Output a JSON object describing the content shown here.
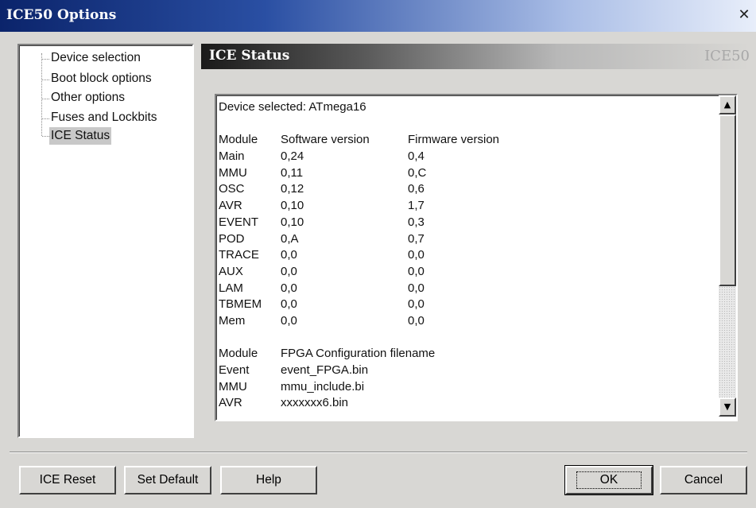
{
  "window": {
    "title": "ICE50 Options",
    "close_glyph": "✕"
  },
  "tree": {
    "items": [
      {
        "label": "Device selection"
      },
      {
        "label": "Boot block options"
      },
      {
        "label": "Other options"
      },
      {
        "label": "Fuses and Lockbits"
      },
      {
        "label": "ICE Status",
        "selected": true
      }
    ]
  },
  "panel": {
    "title": "ICE Status",
    "brand": "ICE50"
  },
  "status": {
    "device_line": "Device selected: ATmega16",
    "versions_header": [
      "Module",
      "Software version",
      "Firmware version"
    ],
    "versions": [
      [
        "Main",
        "0,24",
        "0,4"
      ],
      [
        "MMU",
        "0,11",
        "0,C"
      ],
      [
        "OSC",
        "0,12",
        "0,6"
      ],
      [
        "AVR",
        "0,10",
        "1,7"
      ],
      [
        "EVENT",
        "0,10",
        "0,3"
      ],
      [
        "POD",
        "0,A",
        "0,7"
      ],
      [
        "TRACE",
        "0,0",
        "0,0"
      ],
      [
        "AUX",
        "0,0",
        "0,0"
      ],
      [
        "LAM",
        "0,0",
        "0,0"
      ],
      [
        "TBMEM",
        "0,0",
        "0,0"
      ],
      [
        "Mem",
        "0,0",
        "0,0"
      ]
    ],
    "fpga_header": [
      "Module",
      "FPGA Configuration filename"
    ],
    "fpga": [
      [
        "Event",
        "event_FPGA.bin"
      ],
      [
        "MMU",
        "mmu_include.bi"
      ],
      [
        "AVR",
        "xxxxxxx6.bin"
      ]
    ]
  },
  "scrollbar": {
    "up_glyph": "▲",
    "down_glyph": "▼"
  },
  "buttons": {
    "ice_reset": "ICE Reset",
    "set_default": "Set Default",
    "help": "Help",
    "ok": "OK",
    "cancel": "Cancel"
  }
}
